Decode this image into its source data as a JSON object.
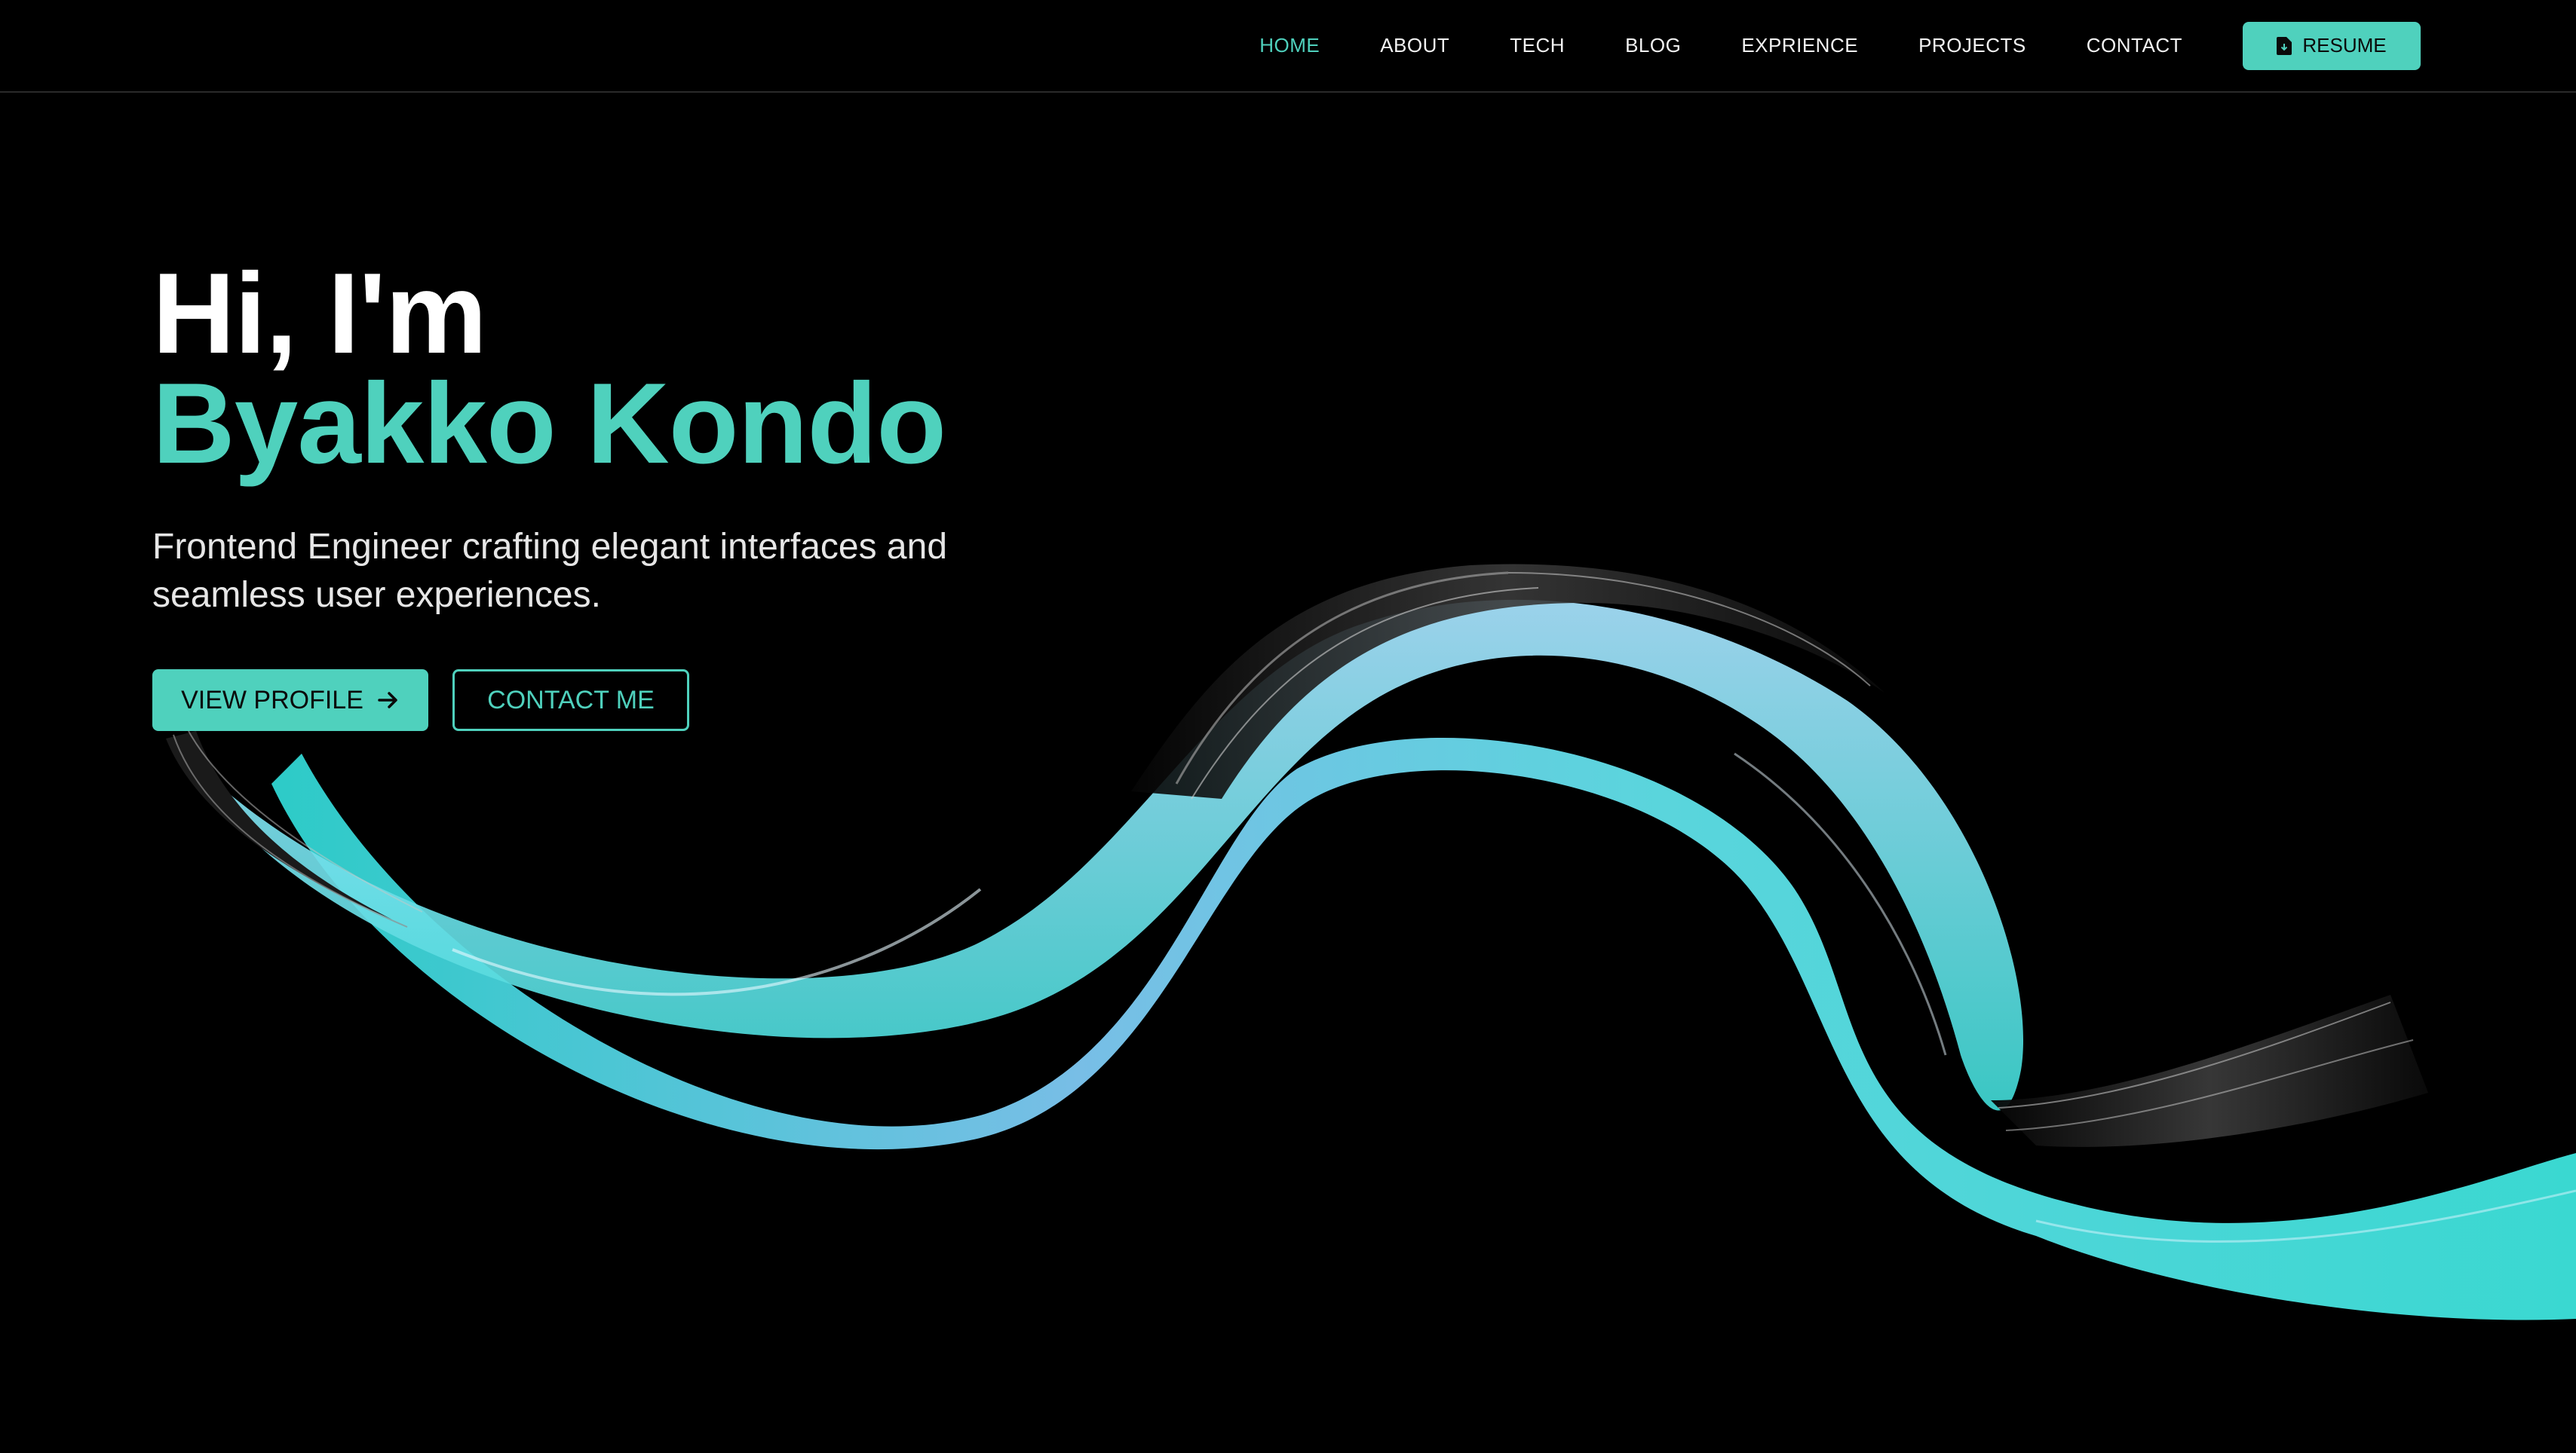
{
  "nav": {
    "items": [
      {
        "label": "HOME",
        "active": true
      },
      {
        "label": "ABOUT"
      },
      {
        "label": "TECH"
      },
      {
        "label": "BLOG"
      },
      {
        "label": "EXPRIENCE"
      },
      {
        "label": "PROJECTS"
      },
      {
        "label": "CONTACT"
      }
    ],
    "resume_label": "RESUME",
    "resume_icon": "file-download-icon"
  },
  "hero": {
    "greeting": "Hi, I'm",
    "name": "Byakko Kondo",
    "tagline": "Frontend Engineer crafting elegant interfaces and seamless user experiences.",
    "primary_button": "VIEW PROFILE",
    "primary_icon": "arrow-right-icon",
    "secondary_button": "CONTACT ME"
  },
  "theme": {
    "background": "#000000",
    "accent": "#4fd1bd",
    "text": "#ffffff",
    "ribbon_colors": [
      "#3ee0d8",
      "#7cc6f0",
      "#a8e6ff",
      "#111111"
    ]
  }
}
